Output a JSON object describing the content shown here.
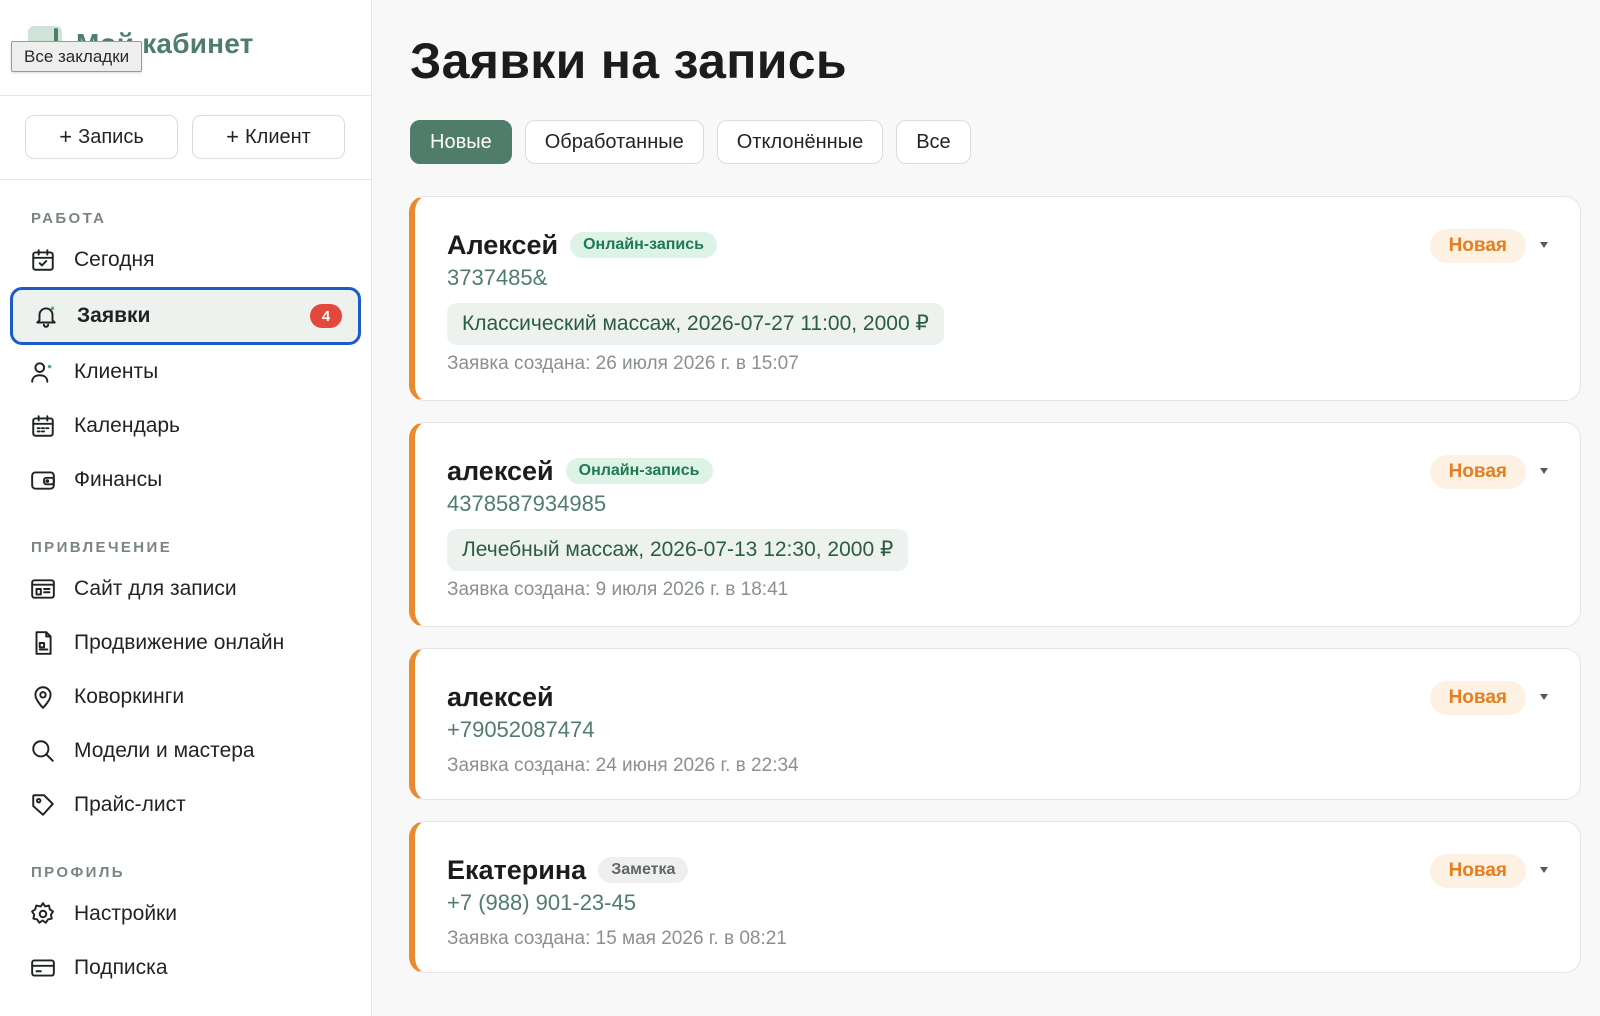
{
  "brand": {
    "title": "Мой кабинет",
    "tooltip": "Все закладки"
  },
  "quick_actions": [
    {
      "plus": "+",
      "label": "Запись"
    },
    {
      "plus": "+",
      "label": "Клиент"
    }
  ],
  "sections": {
    "work": {
      "title": "РАБОТА",
      "items": [
        {
          "label": "Сегодня",
          "icon": "calendar-check-icon"
        },
        {
          "label": "Заявки",
          "icon": "bell-icon",
          "badge": "4",
          "active": true
        },
        {
          "label": "Клиенты",
          "icon": "users-icon"
        },
        {
          "label": "Календарь",
          "icon": "calendar-icon"
        },
        {
          "label": "Финансы",
          "icon": "wallet-icon"
        }
      ]
    },
    "attract": {
      "title": "ПРИВЛЕЧЕНИЕ",
      "items": [
        {
          "label": "Сайт для записи",
          "icon": "website-icon"
        },
        {
          "label": "Продвижение онлайн",
          "icon": "document-icon"
        },
        {
          "label": "Коворкинги",
          "icon": "map-pin-icon"
        },
        {
          "label": "Модели и мастера",
          "icon": "search-icon"
        },
        {
          "label": "Прайс-лист",
          "icon": "tag-icon"
        }
      ]
    },
    "profile": {
      "title": "ПРОФИЛЬ",
      "items": [
        {
          "label": "Настройки",
          "icon": "gear-icon"
        },
        {
          "label": "Подписка",
          "icon": "credit-card-icon"
        }
      ]
    }
  },
  "main": {
    "title": "Заявки на запись",
    "tabs": [
      {
        "label": "Новые",
        "active": true
      },
      {
        "label": "Обработанные"
      },
      {
        "label": "Отклонённые"
      },
      {
        "label": "Все"
      }
    ],
    "requests": [
      {
        "name": "Алексей",
        "tag": "Онлайн-запись",
        "phone": "3737485&",
        "service": "Классический массаж, 2026-07-27 11:00, 2000 ₽",
        "created": "Заявка создана: 26 июля 2026 г. в 15:07",
        "status": "Новая"
      },
      {
        "name": "алексей",
        "tag": "Онлайн-запись",
        "phone": "4378587934985",
        "service": "Лечебный массаж, 2026-07-13 12:30, 2000 ₽",
        "created": "Заявка создана: 9 июля 2026 г. в 18:41",
        "status": "Новая"
      },
      {
        "name": "алексей",
        "phone": "+79052087474",
        "created": "Заявка создана: 24 июня 2026 г. в 22:34",
        "status": "Новая"
      },
      {
        "name": "Екатерина",
        "tag": "Заметка",
        "phone": "+7 (988) 901-23-45",
        "created": "Заявка создана: 15 мая 2026 г. в 08:21",
        "status": "Новая"
      }
    ]
  },
  "colors": {
    "accent": "#4f7d6a",
    "status_orange": "#ea8a2e",
    "badge_red": "#e4473d",
    "focus_blue": "#1c5bc8"
  }
}
